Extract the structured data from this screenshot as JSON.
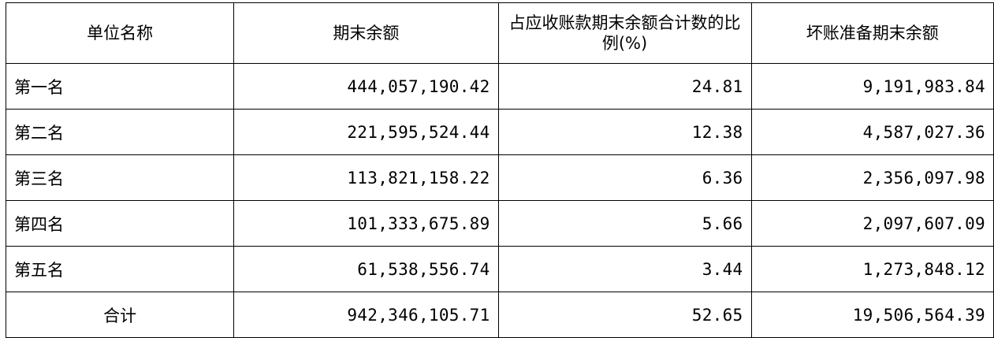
{
  "table": {
    "headers": [
      "单位名称",
      "期末余额",
      "占应收账款期末余额合计数的比例(%)",
      "坏账准备期末余额"
    ],
    "rows": [
      [
        "第一名",
        "444,057,190.42",
        "24.81",
        "9,191,983.84"
      ],
      [
        "第二名",
        "221,595,524.44",
        "12.38",
        "4,587,027.36"
      ],
      [
        "第三名",
        "113,821,158.22",
        "6.36",
        "2,356,097.98"
      ],
      [
        "第四名",
        "101,333,675.89",
        "5.66",
        "2,097,607.09"
      ],
      [
        "第五名",
        "61,538,556.74",
        "3.44",
        "1,273,848.12"
      ]
    ],
    "total": [
      "合计",
      "942,346,105.71",
      "52.65",
      "19,506,564.39"
    ]
  }
}
